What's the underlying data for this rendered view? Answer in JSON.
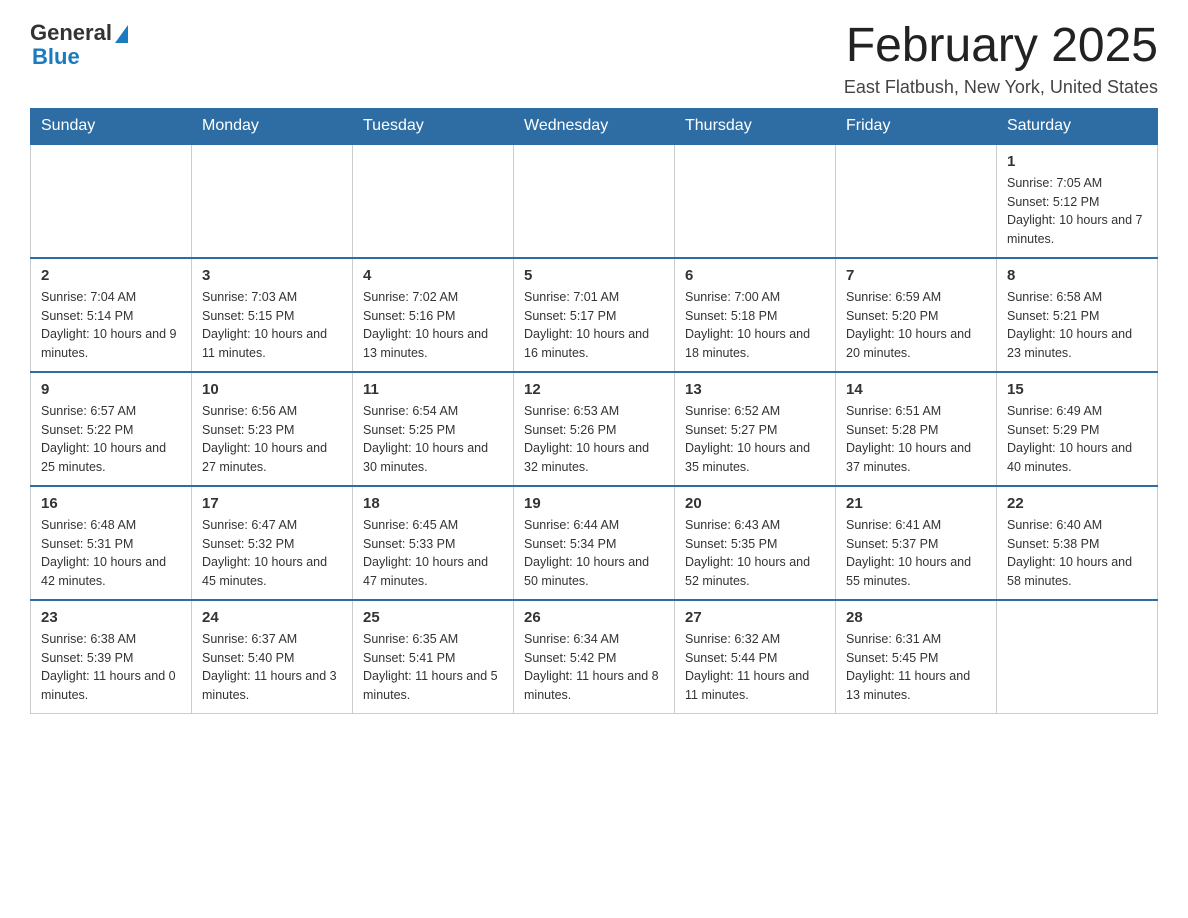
{
  "header": {
    "logo_general": "General",
    "logo_blue": "Blue",
    "title": "February 2025",
    "location": "East Flatbush, New York, United States"
  },
  "days_of_week": [
    "Sunday",
    "Monday",
    "Tuesday",
    "Wednesday",
    "Thursday",
    "Friday",
    "Saturday"
  ],
  "weeks": [
    {
      "days": [
        {
          "number": "",
          "sunrise": "",
          "sunset": "",
          "daylight": "",
          "empty": true
        },
        {
          "number": "",
          "sunrise": "",
          "sunset": "",
          "daylight": "",
          "empty": true
        },
        {
          "number": "",
          "sunrise": "",
          "sunset": "",
          "daylight": "",
          "empty": true
        },
        {
          "number": "",
          "sunrise": "",
          "sunset": "",
          "daylight": "",
          "empty": true
        },
        {
          "number": "",
          "sunrise": "",
          "sunset": "",
          "daylight": "",
          "empty": true
        },
        {
          "number": "",
          "sunrise": "",
          "sunset": "",
          "daylight": "",
          "empty": true
        },
        {
          "number": "1",
          "sunrise": "Sunrise: 7:05 AM",
          "sunset": "Sunset: 5:12 PM",
          "daylight": "Daylight: 10 hours and 7 minutes.",
          "empty": false
        }
      ]
    },
    {
      "days": [
        {
          "number": "2",
          "sunrise": "Sunrise: 7:04 AM",
          "sunset": "Sunset: 5:14 PM",
          "daylight": "Daylight: 10 hours and 9 minutes.",
          "empty": false
        },
        {
          "number": "3",
          "sunrise": "Sunrise: 7:03 AM",
          "sunset": "Sunset: 5:15 PM",
          "daylight": "Daylight: 10 hours and 11 minutes.",
          "empty": false
        },
        {
          "number": "4",
          "sunrise": "Sunrise: 7:02 AM",
          "sunset": "Sunset: 5:16 PM",
          "daylight": "Daylight: 10 hours and 13 minutes.",
          "empty": false
        },
        {
          "number": "5",
          "sunrise": "Sunrise: 7:01 AM",
          "sunset": "Sunset: 5:17 PM",
          "daylight": "Daylight: 10 hours and 16 minutes.",
          "empty": false
        },
        {
          "number": "6",
          "sunrise": "Sunrise: 7:00 AM",
          "sunset": "Sunset: 5:18 PM",
          "daylight": "Daylight: 10 hours and 18 minutes.",
          "empty": false
        },
        {
          "number": "7",
          "sunrise": "Sunrise: 6:59 AM",
          "sunset": "Sunset: 5:20 PM",
          "daylight": "Daylight: 10 hours and 20 minutes.",
          "empty": false
        },
        {
          "number": "8",
          "sunrise": "Sunrise: 6:58 AM",
          "sunset": "Sunset: 5:21 PM",
          "daylight": "Daylight: 10 hours and 23 minutes.",
          "empty": false
        }
      ]
    },
    {
      "days": [
        {
          "number": "9",
          "sunrise": "Sunrise: 6:57 AM",
          "sunset": "Sunset: 5:22 PM",
          "daylight": "Daylight: 10 hours and 25 minutes.",
          "empty": false
        },
        {
          "number": "10",
          "sunrise": "Sunrise: 6:56 AM",
          "sunset": "Sunset: 5:23 PM",
          "daylight": "Daylight: 10 hours and 27 minutes.",
          "empty": false
        },
        {
          "number": "11",
          "sunrise": "Sunrise: 6:54 AM",
          "sunset": "Sunset: 5:25 PM",
          "daylight": "Daylight: 10 hours and 30 minutes.",
          "empty": false
        },
        {
          "number": "12",
          "sunrise": "Sunrise: 6:53 AM",
          "sunset": "Sunset: 5:26 PM",
          "daylight": "Daylight: 10 hours and 32 minutes.",
          "empty": false
        },
        {
          "number": "13",
          "sunrise": "Sunrise: 6:52 AM",
          "sunset": "Sunset: 5:27 PM",
          "daylight": "Daylight: 10 hours and 35 minutes.",
          "empty": false
        },
        {
          "number": "14",
          "sunrise": "Sunrise: 6:51 AM",
          "sunset": "Sunset: 5:28 PM",
          "daylight": "Daylight: 10 hours and 37 minutes.",
          "empty": false
        },
        {
          "number": "15",
          "sunrise": "Sunrise: 6:49 AM",
          "sunset": "Sunset: 5:29 PM",
          "daylight": "Daylight: 10 hours and 40 minutes.",
          "empty": false
        }
      ]
    },
    {
      "days": [
        {
          "number": "16",
          "sunrise": "Sunrise: 6:48 AM",
          "sunset": "Sunset: 5:31 PM",
          "daylight": "Daylight: 10 hours and 42 minutes.",
          "empty": false
        },
        {
          "number": "17",
          "sunrise": "Sunrise: 6:47 AM",
          "sunset": "Sunset: 5:32 PM",
          "daylight": "Daylight: 10 hours and 45 minutes.",
          "empty": false
        },
        {
          "number": "18",
          "sunrise": "Sunrise: 6:45 AM",
          "sunset": "Sunset: 5:33 PM",
          "daylight": "Daylight: 10 hours and 47 minutes.",
          "empty": false
        },
        {
          "number": "19",
          "sunrise": "Sunrise: 6:44 AM",
          "sunset": "Sunset: 5:34 PM",
          "daylight": "Daylight: 10 hours and 50 minutes.",
          "empty": false
        },
        {
          "number": "20",
          "sunrise": "Sunrise: 6:43 AM",
          "sunset": "Sunset: 5:35 PM",
          "daylight": "Daylight: 10 hours and 52 minutes.",
          "empty": false
        },
        {
          "number": "21",
          "sunrise": "Sunrise: 6:41 AM",
          "sunset": "Sunset: 5:37 PM",
          "daylight": "Daylight: 10 hours and 55 minutes.",
          "empty": false
        },
        {
          "number": "22",
          "sunrise": "Sunrise: 6:40 AM",
          "sunset": "Sunset: 5:38 PM",
          "daylight": "Daylight: 10 hours and 58 minutes.",
          "empty": false
        }
      ]
    },
    {
      "days": [
        {
          "number": "23",
          "sunrise": "Sunrise: 6:38 AM",
          "sunset": "Sunset: 5:39 PM",
          "daylight": "Daylight: 11 hours and 0 minutes.",
          "empty": false
        },
        {
          "number": "24",
          "sunrise": "Sunrise: 6:37 AM",
          "sunset": "Sunset: 5:40 PM",
          "daylight": "Daylight: 11 hours and 3 minutes.",
          "empty": false
        },
        {
          "number": "25",
          "sunrise": "Sunrise: 6:35 AM",
          "sunset": "Sunset: 5:41 PM",
          "daylight": "Daylight: 11 hours and 5 minutes.",
          "empty": false
        },
        {
          "number": "26",
          "sunrise": "Sunrise: 6:34 AM",
          "sunset": "Sunset: 5:42 PM",
          "daylight": "Daylight: 11 hours and 8 minutes.",
          "empty": false
        },
        {
          "number": "27",
          "sunrise": "Sunrise: 6:32 AM",
          "sunset": "Sunset: 5:44 PM",
          "daylight": "Daylight: 11 hours and 11 minutes.",
          "empty": false
        },
        {
          "number": "28",
          "sunrise": "Sunrise: 6:31 AM",
          "sunset": "Sunset: 5:45 PM",
          "daylight": "Daylight: 11 hours and 13 minutes.",
          "empty": false
        },
        {
          "number": "",
          "sunrise": "",
          "sunset": "",
          "daylight": "",
          "empty": true
        }
      ]
    }
  ]
}
